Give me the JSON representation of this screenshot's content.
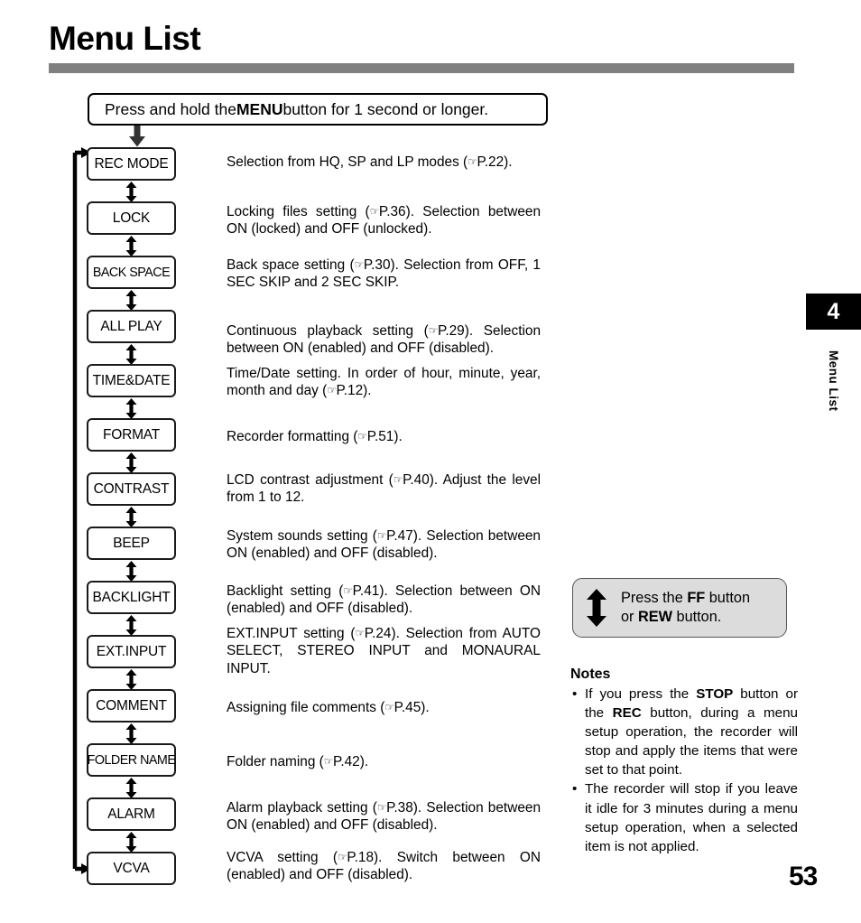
{
  "header": {
    "title": "Menu List"
  },
  "chapter_tab": {
    "number": "4",
    "label": "Menu List"
  },
  "intro": {
    "before": "Press and hold the ",
    "bold": "MENU",
    "after": " button for 1 second or longer."
  },
  "flow": {
    "items": [
      {
        "name": "REC MODE",
        "desc_html": "Selection from  HQ, SP and LP modes (<span class=\"hand\">☞</span>P.22)."
      },
      {
        "name": "LOCK",
        "desc_html": "Locking files setting (<span class=\"hand\">☞</span>P.36). Selection between ON (locked) and OFF (unlocked)."
      },
      {
        "name": "BACK SPACE",
        "desc_html": "Back space setting (<span class=\"hand\">☞</span>P.30). Selection from OFF, 1 SEC SKIP and 2 SEC SKIP."
      },
      {
        "name": "ALL PLAY",
        "desc_html": "Continuous playback setting (<span class=\"hand\">☞</span>P.29). Selection between ON (enabled) and OFF (disabled)."
      },
      {
        "name": "TIME&DATE",
        "desc_html": "Time/Date setting. In order of hour, minute, year, month and day (<span class=\"hand\">☞</span>P.12)."
      },
      {
        "name": "FORMAT",
        "desc_html": "Recorder formatting (<span class=\"hand\">☞</span>P.51)."
      },
      {
        "name": "CONTRAST",
        "desc_html": "LCD contrast adjustment  (<span class=\"hand\">☞</span>P.40). Adjust the level from 1 to 12."
      },
      {
        "name": "BEEP",
        "desc_html": "System sounds setting (<span class=\"hand\">☞</span>P.47). Selection between ON (enabled) and OFF (disabled)."
      },
      {
        "name": "BACKLIGHT",
        "desc_html": "Backlight setting (<span class=\"hand\">☞</span>P.41). Selection between ON (enabled) and OFF (disabled)."
      },
      {
        "name": "EXT.INPUT",
        "desc_html": "EXT.INPUT setting (<span class=\"hand\">☞</span>P.24). Selection from AUTO SELECT, STEREO INPUT and MONAURAL INPUT."
      },
      {
        "name": "COMMENT",
        "desc_html": "Assigning file comments (<span class=\"hand\">☞</span>P.45)."
      },
      {
        "name": "FOLDER NAME",
        "desc_html": "Folder naming (<span class=\"hand\">☞</span>P.42)."
      },
      {
        "name": "ALARM",
        "desc_html": "Alarm playback setting (<span class=\"hand\">☞</span>P.38). Selection between ON (enabled) and OFF (disabled)."
      },
      {
        "name": "VCVA",
        "desc_html": "VCVA setting (<span class=\"hand\">☞</span>P.18).  Switch between ON (enabled) and OFF (disabled)."
      }
    ]
  },
  "ffrew_callout": {
    "line1_before": "Press the ",
    "line1_bold": "FF",
    "line1_after": " button",
    "line2_before": "or ",
    "line2_bold": "REW",
    "line2_after": " button.",
    "icon": "up-down-arrow-icon"
  },
  "notes": {
    "title": "Notes",
    "bullet": "•",
    "items_html": [
      "If you press the <b>STOP</b> button or the <b>REC</b> button, during a menu setup operation, the recorder will stop and apply the items that were set to that point.",
      "The recorder will stop if you leave it idle for 3 minutes during a menu setup operation, when a selected item is not applied."
    ]
  },
  "page_number": "53",
  "colors": {
    "rule": "#808080",
    "callout_bg": "#dcdcdc",
    "tab_bg": "#000000",
    "ink": "#000000"
  }
}
